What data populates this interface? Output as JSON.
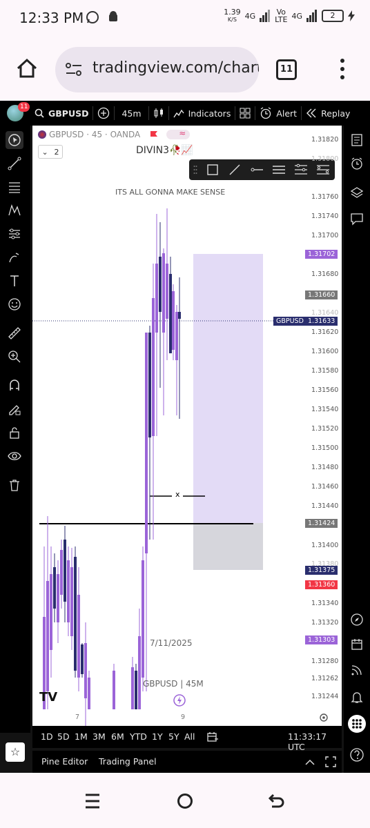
{
  "status": {
    "time": "12:33 PM",
    "speed": "1.39",
    "speed_unit": "K/S",
    "net1": "4G",
    "volte_line1": "Vo",
    "volte_line2": "LTE",
    "net2": "4G",
    "battery_count": "2"
  },
  "browser": {
    "url": "tradingview.com/chart",
    "tabs": "11"
  },
  "toolbar": {
    "avatar_badge": "11",
    "symbol": "GBPUSD",
    "interval": "45m",
    "indicators": "Indicators",
    "alert": "Alert",
    "replay": "Replay"
  },
  "legend": {
    "symbol_line": "GBPUSD · 45 · OANDA",
    "collapse_count": "2"
  },
  "chart": {
    "title": "DIVIN3🥀📈",
    "subtitle": "ITS ALL GONNA MAKE SENSE",
    "date_watermark": "7/11/2025",
    "symbol_watermark": "GBPUSD | 45M",
    "x_marker": "x",
    "time_ticks": [
      "7",
      "9"
    ],
    "price_axis": [
      "1.31820",
      "1.31800",
      "1.31760",
      "1.31740",
      "1.31700",
      "1.31680",
      "1.31640",
      "1.31620",
      "1.31600",
      "1.31580",
      "1.31560",
      "1.31540",
      "1.31520",
      "1.31500",
      "1.31480",
      "1.31460",
      "1.31440",
      "1.31400",
      "1.31380",
      "1.31340",
      "1.31320",
      "1.31280",
      "1.31262",
      "1.31244"
    ],
    "price_tags": {
      "upper": "1.31702",
      "gray1": "1.31660",
      "pair": "GBPUSD",
      "current": "1.31633",
      "level": "1.31424",
      "navy": "1.31375",
      "red": "1.31360",
      "lower": "1.31303"
    }
  },
  "timeframes": [
    "1D",
    "5D",
    "1M",
    "3M",
    "6M",
    "YTD",
    "1Y",
    "5Y",
    "All"
  ],
  "clock": "11:33:17 UTC",
  "bottom": {
    "pine": "Pine Editor",
    "trading": "Trading Panel"
  },
  "colors": {
    "purple": "#9b64d8",
    "navy": "#2a2e6e",
    "zone_purple": "#e3dbf6",
    "zone_gray": "#d6d6dc",
    "red_tag": "#f23645"
  }
}
